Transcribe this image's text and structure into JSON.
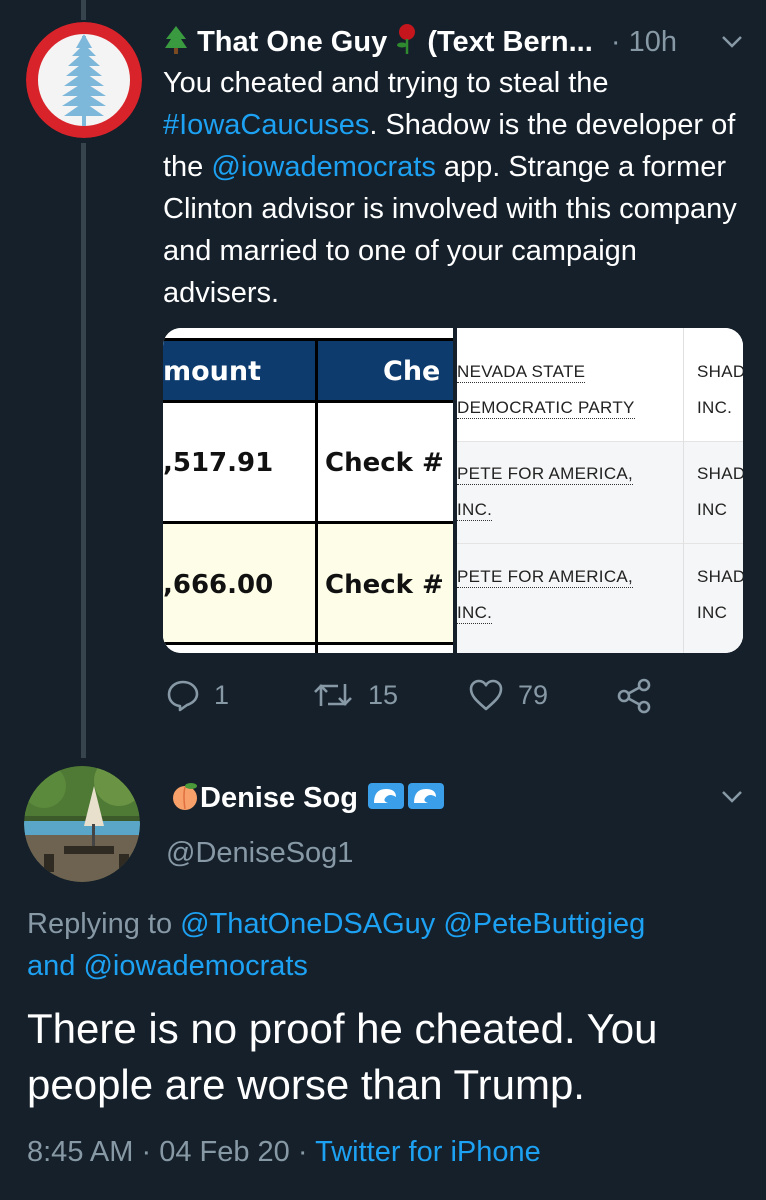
{
  "tweet": {
    "author": {
      "prefix_emoji": "evergreen-tree-icon",
      "name": "That One Guy",
      "rose_emoji": "rose-icon",
      "name_suffix": "(Text Bern...",
      "time_sep": "·",
      "time": "10h"
    },
    "text": {
      "part1": "You cheated and trying to steal the ",
      "hashtag": "#IowaCaucuses",
      "part2": ". Shadow is the developer of the ",
      "mention": "@iowademocrats",
      "part3": " app. Strange a former Clinton advisor is involved with this company and married to one of your campaign advisers."
    },
    "media": {
      "left": {
        "header_amount": "mount",
        "header_check": "Che",
        "rows": [
          {
            "amount": ",517.91",
            "check": "Check #"
          },
          {
            "amount": ",666.00",
            "check": "Check #"
          }
        ]
      },
      "right": {
        "rows": [
          {
            "payer_line1": "NEVADA STATE",
            "payer_line2": "DEMOCRATIC PARTY",
            "vendor_line1": "SHAD",
            "vendor_line2": "INC."
          },
          {
            "payer_line1": "PETE FOR AMERICA,",
            "payer_line2": "INC.",
            "vendor_line1": "SHAD",
            "vendor_line2": "INC"
          },
          {
            "payer_line1": "PETE FOR AMERICA,",
            "payer_line2": "INC.",
            "vendor_line1": "SHAD",
            "vendor_line2": "INC"
          }
        ]
      }
    },
    "actions": {
      "replies": "1",
      "retweets": "15",
      "likes": "79"
    }
  },
  "reply": {
    "name_emoji": "peach-icon",
    "name": "Denise Sog",
    "name_suffix_emoji": "wave-icon",
    "handle": "@DeniseSog1",
    "replying_prefix": "Replying to ",
    "replying_to_1": "@ThatOneDSAGuy",
    "replying_to_2": "@PeteButtigieg",
    "replying_and": "and ",
    "replying_to_3": "@iowademocrats",
    "text": "There is no proof he cheated. You people are worse than Trump.",
    "time": "8:45 AM",
    "sep1": "·",
    "date": "04 Feb 20",
    "sep2": "·",
    "client": "Twitter for iPhone"
  },
  "colors": {
    "background": "#15202b",
    "link": "#1da1f2",
    "muted": "#8899a6",
    "thread_line": "#38444d",
    "avatar_red": "#d8232a",
    "tree_blue": "#7db7d9"
  }
}
